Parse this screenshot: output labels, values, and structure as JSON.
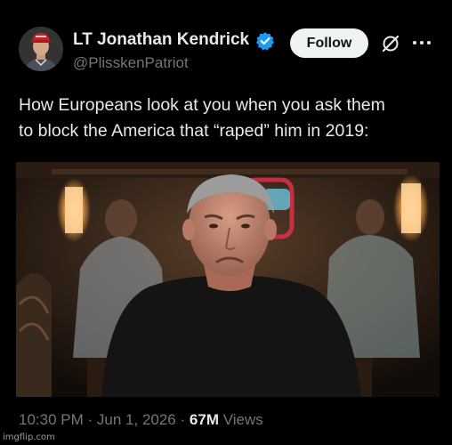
{
  "author": {
    "display_name": "LT Jonathan Kendrick",
    "handle": "@PlisskenPatriot",
    "verified_color": "#1d9bf0",
    "avatar_cap_text": "MAKE AMERICA"
  },
  "actions": {
    "follow_label": "Follow",
    "grok_icon": "grok-icon",
    "more_icon": "more-icon"
  },
  "tweet": {
    "line1": "How Europeans look at you when you ask them",
    "line2": "to block the America that “raped” him in 2019:"
  },
  "media": {
    "description_icon": "photo"
  },
  "meta": {
    "time": "10:30 PM",
    "separator": "·",
    "date": "Jun 1, 2026",
    "views_count": "67M",
    "views_label": "Views"
  },
  "watermark": {
    "text": "imgflip.com"
  },
  "colors": {
    "background": "#000000",
    "text_primary": "#e7e9ea",
    "text_secondary": "#71767b",
    "follow_bg": "#eff3f4"
  }
}
